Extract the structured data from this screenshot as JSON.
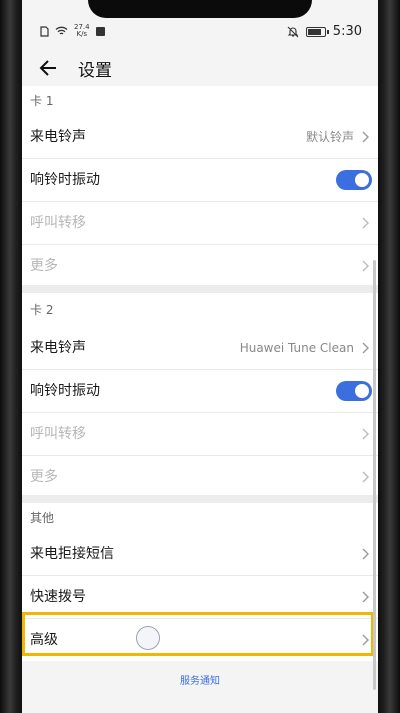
{
  "status_bar": {
    "speed_value": "27.4",
    "speed_unit": "K/s",
    "time": "5:30"
  },
  "header": {
    "title": "设置"
  },
  "card1": {
    "label": "卡 1",
    "rows": [
      {
        "label": "来电铃声",
        "value": "默认铃声"
      },
      {
        "label": "响铃时振动",
        "toggle": true
      },
      {
        "label": "呼叫转移",
        "disabled": true
      },
      {
        "label": "更多",
        "disabled": true
      }
    ]
  },
  "card2": {
    "label": "卡 2",
    "rows": [
      {
        "label": "来电铃声",
        "value": "Huawei Tune Clean"
      },
      {
        "label": "响铃时振动",
        "toggle": true
      },
      {
        "label": "呼叫转移",
        "disabled": true
      },
      {
        "label": "更多",
        "disabled": true
      }
    ]
  },
  "other": {
    "label": "其他",
    "rows": [
      {
        "label": "来电拒接短信"
      },
      {
        "label": "快速拨号"
      },
      {
        "label": "高级"
      }
    ]
  },
  "footer": {
    "link": "服务通知"
  },
  "colors": {
    "accent": "#3b6fe0",
    "highlight": "#f2b705"
  }
}
